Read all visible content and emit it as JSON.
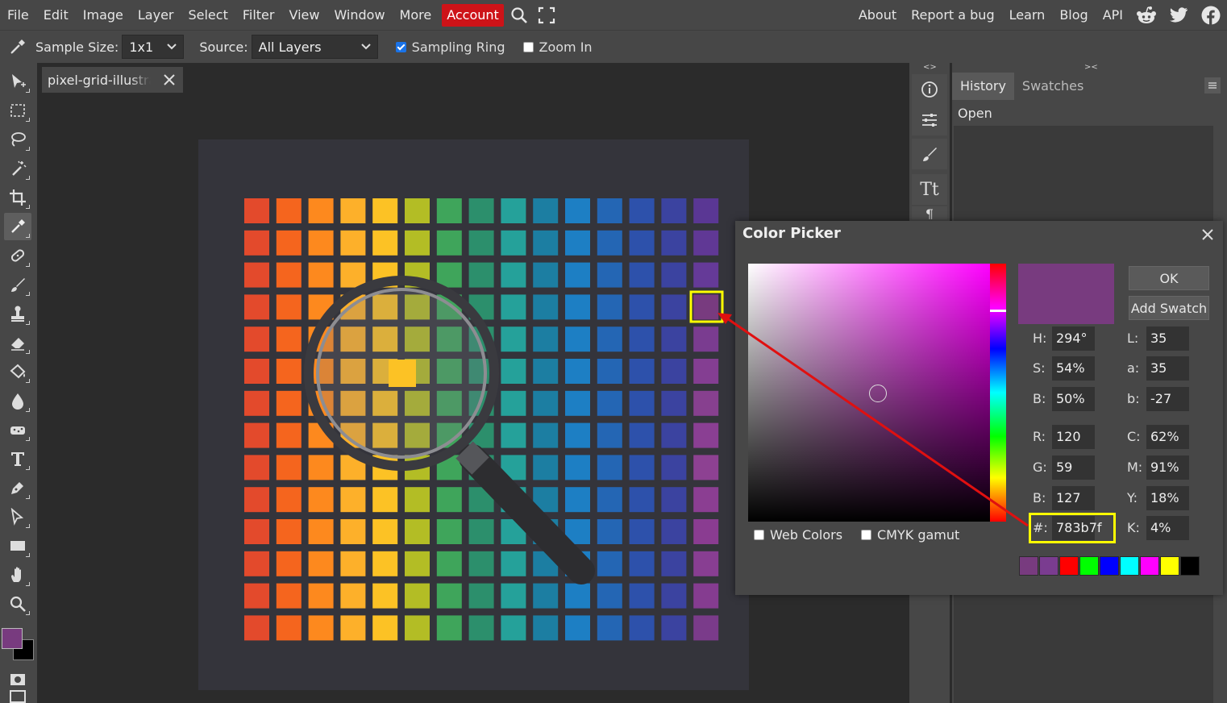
{
  "menu": {
    "items": [
      "File",
      "Edit",
      "Image",
      "Layer",
      "Select",
      "Filter",
      "View",
      "Window",
      "More"
    ],
    "account": "Account",
    "right": [
      "About",
      "Report a bug",
      "Learn",
      "Blog",
      "API"
    ],
    "icons": [
      "search-icon",
      "fullscreen-icon",
      "reddit-icon",
      "twitter-icon",
      "facebook-icon"
    ],
    "account_color": "#cd1318"
  },
  "options": {
    "sample_size_label": "Sample Size:",
    "sample_size_value": "1x1",
    "source_label": "Source:",
    "source_value": "All Layers",
    "sampling_ring_label": "Sampling Ring",
    "sampling_ring_checked": true,
    "zoom_in_label": "Zoom In",
    "zoom_in_checked": false
  },
  "toolbar": {
    "tools": [
      "move-tool-icon",
      "marquee-tool-icon",
      "lasso-tool-icon",
      "magic-wand-icon",
      "crop-tool-icon",
      "eyedropper-tool-icon",
      "healing-brush-icon",
      "brush-tool-icon",
      "clone-stamp-icon",
      "eraser-tool-icon",
      "paint-bucket-icon",
      "blur-tool-icon",
      "sponge-tool-icon",
      "type-tool-icon",
      "pen-tool-icon",
      "path-select-icon",
      "shape-tool-icon",
      "hand-tool-icon",
      "zoom-tool-icon"
    ],
    "active_tool": "eyedropper-tool-icon",
    "foreground_color": "#783b7f",
    "background_color": "#000000"
  },
  "document": {
    "tab_name": "pixel-grid-illustration"
  },
  "panels": {
    "side_buttons": [
      "info-icon",
      "adjustments-icon",
      "brush-settings-icon",
      "character-icon",
      "paragraph-icon"
    ],
    "tabs": [
      "History",
      "Swatches"
    ],
    "active_tab": "History",
    "history_items": [
      "Open"
    ]
  },
  "canvas": {
    "grid_colors": [
      "#e34a2c",
      "#f5651e",
      "#fd891e",
      "#fdb02a",
      "#fcc225",
      "#b3bd25",
      "#3fa55b",
      "#2c8f6c",
      "#25a19a",
      "#1c7ea2",
      "#1d7fc4",
      "#2466b4",
      "#2d51ab",
      "#3b43a0",
      "#5b3a94"
    ],
    "last_column_colors": [
      "#5a3794",
      "#603895",
      "#653a98",
      "#783b7f",
      "#7a3c90",
      "#843e92",
      "#87408f",
      "#8a3f93",
      "#8d4192",
      "#8b3e92",
      "#8a3c91",
      "#883e92",
      "#853c90",
      "#7a3b8a"
    ],
    "highlight_color": "#ffff00",
    "arrow_color": "#e01010"
  },
  "color_picker": {
    "title": "Color Picker",
    "ok": "OK",
    "add_swatch": "Add Swatch",
    "selected_color": "#783b7f",
    "hsb": [
      {
        "k": "H:",
        "v": "294°"
      },
      {
        "k": "S:",
        "v": "54%"
      },
      {
        "k": "B:",
        "v": "50%"
      }
    ],
    "lab": [
      {
        "k": "L:",
        "v": "35"
      },
      {
        "k": "a:",
        "v": "35"
      },
      {
        "k": "b:",
        "v": "-27"
      }
    ],
    "rgb": [
      {
        "k": "R:",
        "v": "120"
      },
      {
        "k": "G:",
        "v": "59"
      },
      {
        "k": "B:",
        "v": "127"
      }
    ],
    "cmyk": [
      {
        "k": "C:",
        "v": "62%"
      },
      {
        "k": "M:",
        "v": "91%"
      },
      {
        "k": "Y:",
        "v": "18%"
      },
      {
        "k": "K:",
        "v": "4%"
      }
    ],
    "hex_label": "#:",
    "hex_value": "783b7f",
    "web_colors_label": "Web Colors",
    "cmyk_gamut_label": "CMYK gamut",
    "recent_swatches": [
      "#783b7f",
      "#7a3c90",
      "#ff0000",
      "#00ff00",
      "#0000ff",
      "#00ffff",
      "#ff00ff",
      "#ffff00",
      "#000000"
    ]
  }
}
